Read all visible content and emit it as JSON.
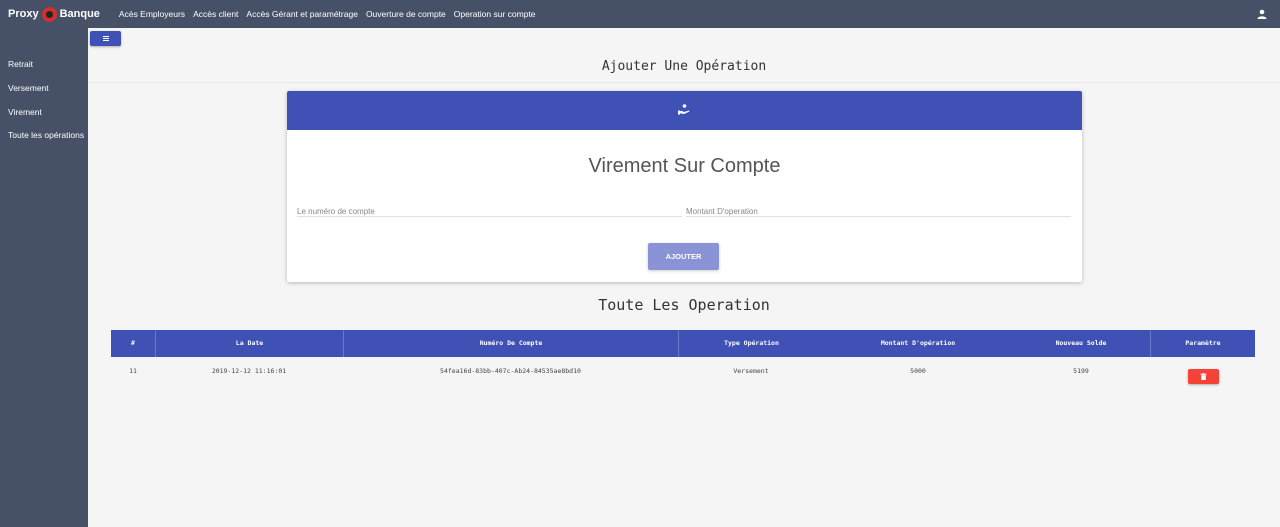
{
  "navbar": {
    "brand_left": "Proxy",
    "brand_right": "Banque",
    "links": [
      "Acès Employeurs",
      "Accès client",
      "Accès Gérant et paramétrage",
      "Ouverture de compte",
      "Operation sur compte"
    ],
    "user_icon": "user-icon"
  },
  "sidebar": {
    "items": [
      "Retrait",
      "Versement",
      "Virement",
      "Toute les opérations"
    ]
  },
  "toggle_icon": "menu-icon",
  "page_title": "Ajouter Une Opération",
  "form": {
    "header_icon": "hand-coin-icon",
    "title": "Virement Sur Compte",
    "account_placeholder": "Le numéro de compte",
    "amount_placeholder": "Montant D'operation",
    "submit_label": "AJOUTER"
  },
  "operations": {
    "title": "Toute Les Operation",
    "columns": [
      "#",
      "La Date",
      "Numéro De Compte",
      "Type Opération",
      "Montant D'opération",
      "Nouveau Solde",
      "Paramètre"
    ],
    "rows": [
      {
        "id": "11",
        "date": "2019-12-12 11:16:01",
        "account": "54fea16d-83bb-407c-Ab24-84535ae8bd10",
        "type": "Versement",
        "amount": "5000",
        "balance": "5199",
        "action_icon": "trash-icon"
      }
    ]
  },
  "colors": {
    "navbar": "#465167",
    "primary": "#3f51b5",
    "button_light": "#8a93d6",
    "danger": "#f44336",
    "background": "#f5f5f5"
  }
}
